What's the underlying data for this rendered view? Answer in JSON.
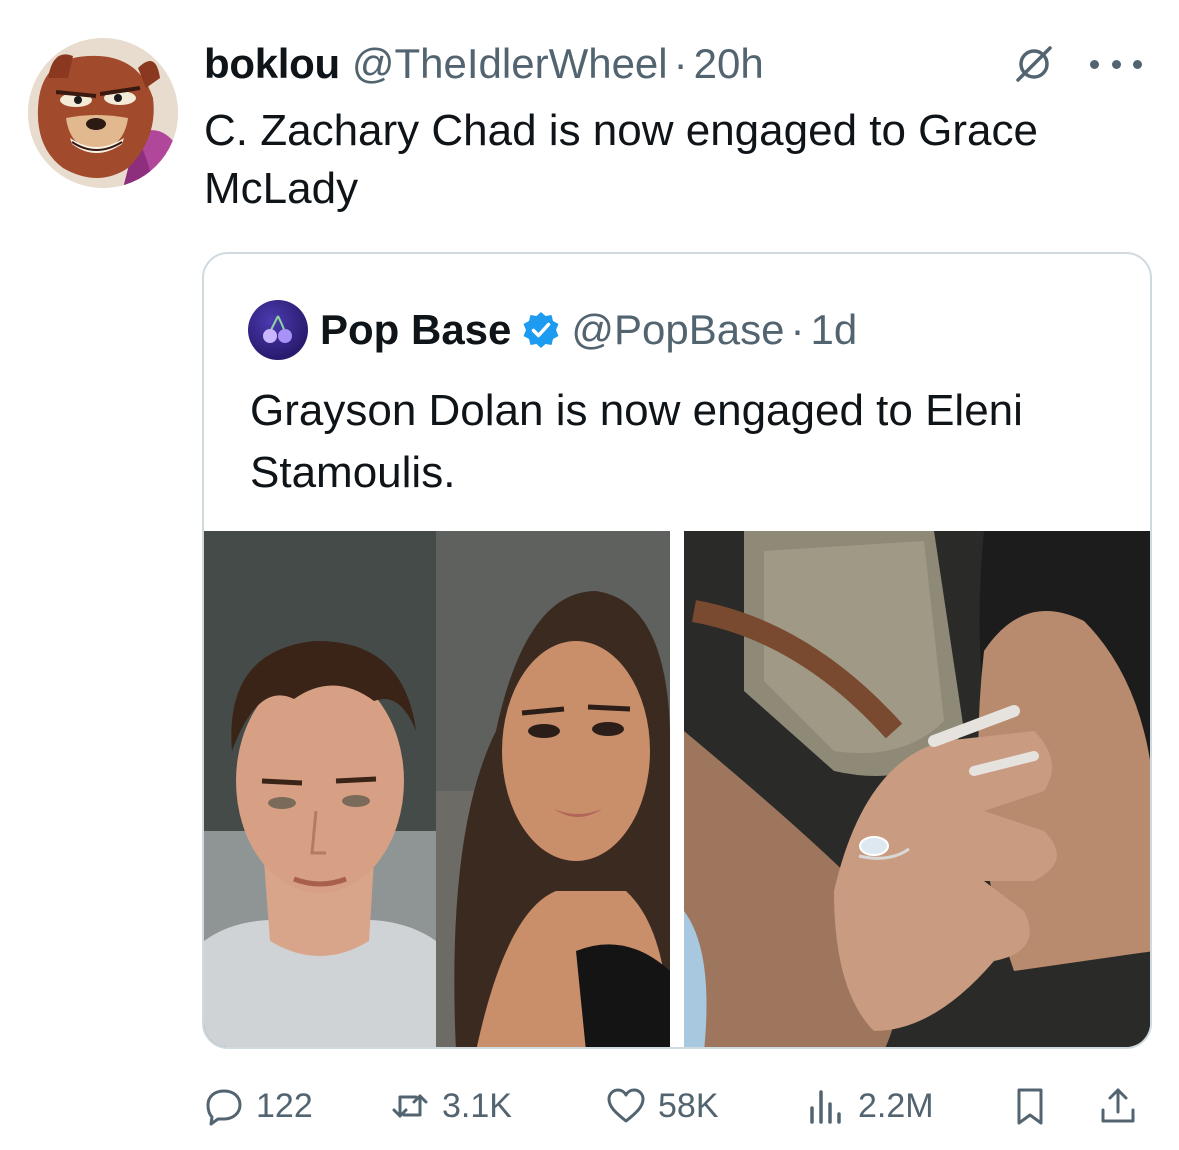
{
  "tweet": {
    "display_name": "boklou",
    "handle": "@TheIdlerWheel",
    "separator": "·",
    "time": "20h",
    "text": "C. Zachary Chad is now engaged to Grace McLady"
  },
  "quote": {
    "display_name": "Pop Base",
    "handle": "@PopBase",
    "separator": "·",
    "time": "1d",
    "text": "Grayson Dolan is now engaged to Eleni Stamoulis."
  },
  "actions": {
    "replies": "122",
    "reposts": "3.1K",
    "likes": "58K",
    "views": "2.2M"
  },
  "icons": {
    "grok": "grok-icon",
    "more": "more-icon",
    "verified": "verified-badge-icon",
    "reply": "reply-icon",
    "repost": "repost-icon",
    "like": "heart-icon",
    "views": "views-icon",
    "bookmark": "bookmark-icon",
    "share": "share-icon"
  },
  "colors": {
    "text": "#0f1419",
    "secondary": "#536471",
    "border": "#cfd9de",
    "verified": "#1d9bf0"
  }
}
